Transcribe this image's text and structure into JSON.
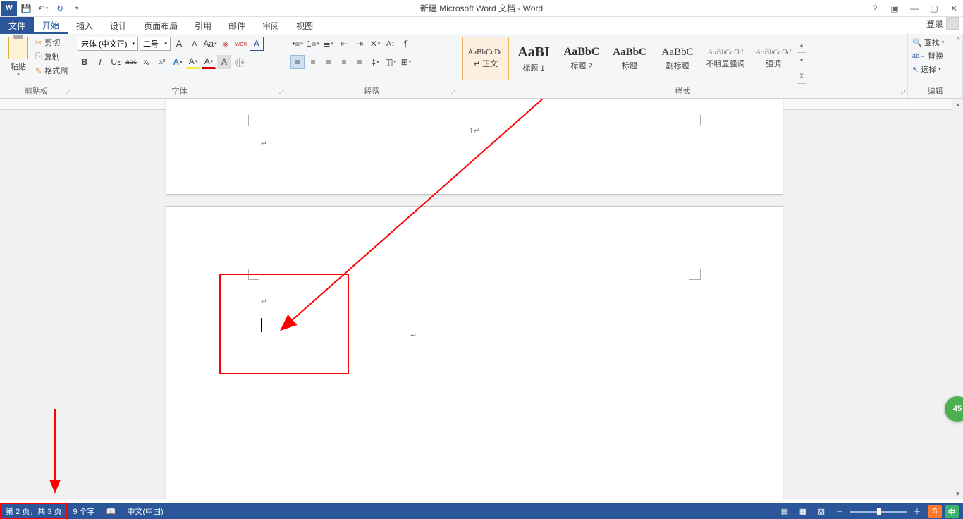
{
  "title": "新建 Microsoft Word 文档 - Word",
  "qat": {
    "word": "W",
    "save": "💾",
    "undo": "↶",
    "redo": "↻"
  },
  "winctrl": {
    "help": "?",
    "ropt": "▣",
    "min": "—",
    "max": "▢",
    "close": "✕"
  },
  "tabs": {
    "file": "文件",
    "home": "开始",
    "insert": "插入",
    "design": "设计",
    "layout": "页面布局",
    "ref": "引用",
    "mail": "邮件",
    "review": "审阅",
    "view": "视图"
  },
  "login": "登录",
  "clipboard": {
    "paste": "粘贴",
    "cut": "剪切",
    "copy": "复制",
    "brush": "格式刷",
    "label": "剪贴板"
  },
  "font": {
    "name": "宋体 (中文正)",
    "size": "二号",
    "grow": "A",
    "shrink": "A",
    "case": "Aa",
    "py": "wén",
    "charborder": "A",
    "bold": "B",
    "italic": "I",
    "underline": "U",
    "strike": "abc",
    "sub": "x₂",
    "sup": "x²",
    "txtfx": "A",
    "hilite": "A",
    "color": "A",
    "charshade": "A",
    "clear": "◈",
    "label": "字体"
  },
  "para": {
    "bullets": "≡",
    "numbers": "≡",
    "ml": "≡",
    "dedent": "⇤",
    "indent": "⇥",
    "sortaz": "A↕",
    "marks": "¶",
    "al": "≡",
    "ac": "≡",
    "ar": "≡",
    "aj": "≡",
    "dist": "≡",
    "spacing": "‡",
    "shading": "◫",
    "borders": "⊞",
    "label": "段落"
  },
  "styles": {
    "items": [
      {
        "prev": "AaBbCcDd",
        "name": "↵ 正文",
        "size": "11px"
      },
      {
        "prev": "AaBI",
        "name": "标题 1",
        "size": "20px",
        "bold": true
      },
      {
        "prev": "AaBbC",
        "name": "标题 2",
        "size": "16px",
        "bold": true
      },
      {
        "prev": "AaBbC",
        "name": "标题",
        "size": "15px",
        "bold": true
      },
      {
        "prev": "AaBbC",
        "name": "副标题",
        "size": "15px"
      },
      {
        "prev": "AaBbCcDd",
        "name": "不明显强调",
        "size": "11px",
        "italic": true
      },
      {
        "prev": "AaBbCcDd",
        "name": "强调",
        "size": "11px",
        "italic": true
      }
    ],
    "label": "样式"
  },
  "edit": {
    "find": "查找",
    "replace": "替换",
    "select": "选择",
    "label": "编辑"
  },
  "doc": {
    "pagenum1": "1↵",
    "mark": "↵"
  },
  "status": {
    "page": "第 2 页，共 3 页",
    "words": "9 个字",
    "proof": "✓",
    "lang": "中文(中国)",
    "zoom": "100%",
    "zminus": "－",
    "zplus": "＋"
  },
  "green": "45",
  "ime": {
    "s": "S",
    "cn": "中"
  }
}
